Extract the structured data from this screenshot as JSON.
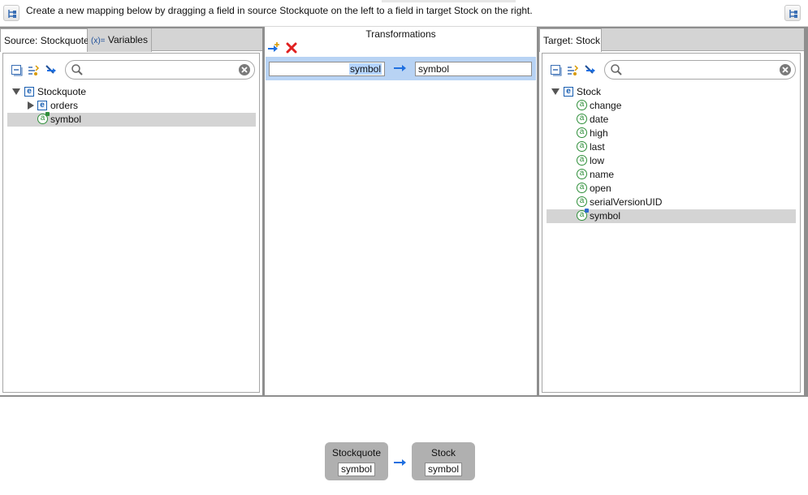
{
  "instruction": "Create a new mapping below by dragging a field in source Stockquote on the left to a field in target Stock on the right.",
  "icons": {
    "left_toolbar": "tree-layout-icon",
    "right_toolbar": "tree-layout-icon",
    "collapse": "collapse-all-icon",
    "filter": "show-mapped-icon",
    "link": "mapped-fields-icon",
    "search": "search-icon",
    "clear": "clear-icon",
    "add": "add-mapping-icon",
    "delete": "delete-mapping-icon"
  },
  "source": {
    "tabs": [
      {
        "label": "Source: Stockquote",
        "icon": ""
      },
      {
        "label": "Variables",
        "icon": "(x)="
      }
    ],
    "search_value": "",
    "tree": {
      "root": "Stockquote",
      "items": [
        {
          "label": "orders",
          "type": "element",
          "expandable": true
        },
        {
          "label": "symbol",
          "type": "attribute",
          "selected": true
        }
      ]
    }
  },
  "transformations": {
    "title": "Transformations",
    "mappings": [
      {
        "source": "symbol",
        "target": "symbol"
      }
    ]
  },
  "target": {
    "tab_label": "Target: Stock",
    "search_value": "",
    "tree": {
      "root": "Stock",
      "items": [
        {
          "label": "change"
        },
        {
          "label": "date"
        },
        {
          "label": "high"
        },
        {
          "label": "last"
        },
        {
          "label": "low"
        },
        {
          "label": "name"
        },
        {
          "label": "open"
        },
        {
          "label": "serialVersionUID"
        },
        {
          "label": "symbol",
          "selected": true
        }
      ]
    }
  },
  "diagram": {
    "source_node": {
      "title": "Stockquote",
      "field": "symbol"
    },
    "target_node": {
      "title": "Stock",
      "field": "symbol"
    }
  },
  "colors": {
    "selection": "#d4d4d4",
    "mapping_row": "#b8d3f4",
    "arrow": "#1e6fe0",
    "delete": "#e02020"
  }
}
